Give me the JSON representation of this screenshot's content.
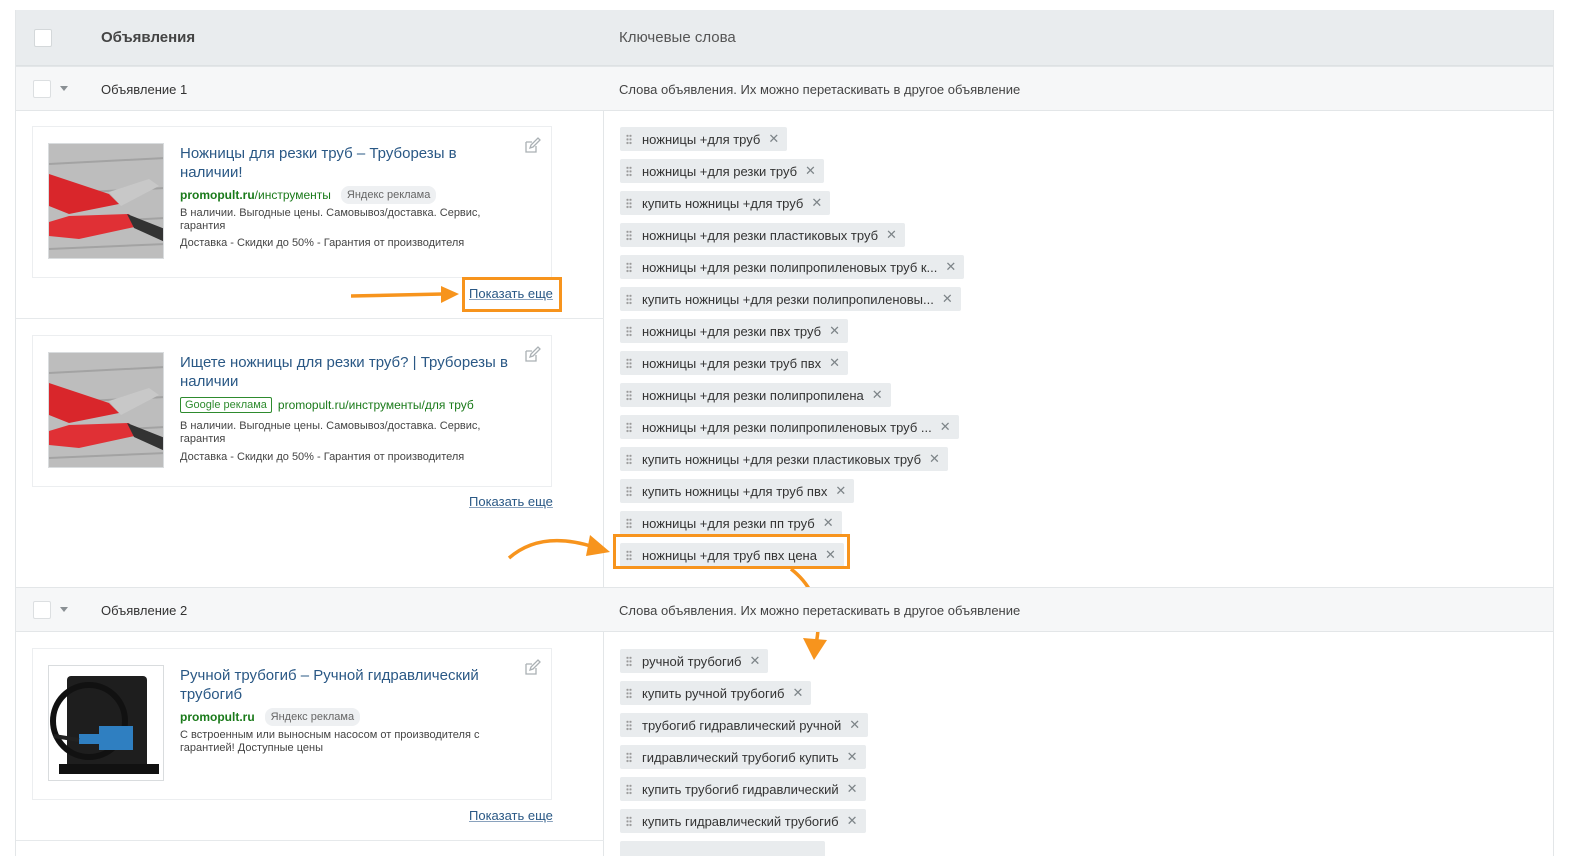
{
  "header": {
    "ads_col": "Объявления",
    "keywords_col": "Ключевые слова"
  },
  "groups": [
    {
      "title": "Объявление 1",
      "hint": "Слова объявления. Их можно перетаскивать в другое объявление",
      "ads": [
        {
          "title": "Ножницы для резки труб – Труборезы в наличии!",
          "domain": "promopult.ru",
          "path": "/инструменты",
          "badge": "Яндекс реклама",
          "desc": "В наличии. Выгодные цены. Самовывоз/доставка. Сервис, гарантия",
          "desc2": "Доставка - Скидки до 50% - Гарантия от производителя",
          "show_more": "Показать еще"
        },
        {
          "title": "Ищете ножницы для резки труб? | Труборезы в наличии",
          "badge": "Google реклама",
          "url": "promopult.ru/инструменты/для труб",
          "desc": "В наличии. Выгодные цены. Самовывоз/доставка. Сервис, гарантия",
          "desc2": "Доставка - Скидки до 50% - Гарантия от производителя",
          "show_more": "Показать еще"
        }
      ],
      "keywords": [
        "ножницы +для труб",
        "ножницы +для резки труб",
        "купить ножницы +для труб",
        "ножницы +для резки пластиковых труб",
        "ножницы +для резки полипропиленовых труб к...",
        "купить ножницы +для резки полипропиленовы...",
        "ножницы +для резки пвх труб",
        "ножницы +для резки труб пвх",
        "ножницы +для резки полипропилена",
        "ножницы +для резки полипропиленовых труб ...",
        "купить ножницы +для резки пластиковых труб",
        "купить ножницы +для труб пвх",
        "ножницы +для резки пп труб",
        "ножницы +для труб пвх цена"
      ]
    },
    {
      "title": "Объявление 2",
      "hint": "Слова объявления. Их можно перетаскивать в другое объявление",
      "ads": [
        {
          "title": "Ручной трубогиб – Ручной гидравлический трубогиб",
          "domain": "promopult.ru",
          "badge": "Яндекс реклама",
          "desc": "С встроенным или выносным насосом от производителя с гарантией! Доступные цены",
          "show_more": "Показать еще"
        }
      ],
      "keywords": [
        "ручной трубогиб",
        "купить ручной трубогиб",
        "трубогиб гидравлический ручной",
        "гидравлический трубогиб купить",
        "купить трубогиб гидравлический",
        "купить гидравлический трубогиб"
      ]
    }
  ],
  "colors": {
    "accent": "#f7941d",
    "link": "#2a5885",
    "domain": "#1a7a1a"
  }
}
